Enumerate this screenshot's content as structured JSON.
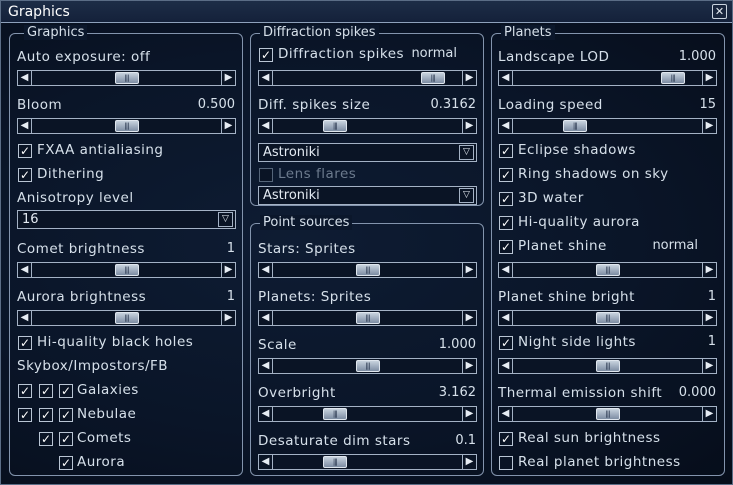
{
  "window": {
    "title": "Graphics",
    "close_glyph": "✕"
  },
  "icons": {
    "check": "✓",
    "left": "◀",
    "right": "▶",
    "thumb": "|||",
    "dropdown": "▽"
  },
  "graphics": {
    "title": "Graphics",
    "auto_exposure_label": "Auto exposure: off",
    "auto_exposure_pos": 0.5,
    "bloom_label": "Bloom",
    "bloom_value": "0.500",
    "bloom_pos": 0.5,
    "fxaa_label": "FXAA antialiasing",
    "fxaa_checked": true,
    "dithering_label": "Dithering",
    "dithering_checked": true,
    "anisotropy_label": "Anisotropy level",
    "anisotropy_value": "16",
    "comet_label": "Comet brightness",
    "comet_value": "1",
    "comet_pos": 0.5,
    "aurora_label": "Aurora brightness",
    "aurora_value": "1",
    "aurora_pos": 0.5,
    "hq_black_holes_label": "Hi-quality black holes",
    "hq_black_holes_checked": true,
    "skybox_label": "Skybox/Impostors/FB",
    "galaxies_label": "Galaxies",
    "nebulae_label": "Nebulae",
    "comets_label": "Comets",
    "aurora_item_label": "Aurora"
  },
  "diffraction": {
    "title": "Diffraction spikes",
    "spikes_label": "Diffraction spikes",
    "spikes_mode": "normal",
    "spikes_checked": true,
    "spikes_pos": 0.9,
    "size_label": "Diff. spikes size",
    "size_value": "0.3162",
    "size_pos": 0.3,
    "dropdown1_value": "Astroniki",
    "lens_flares_label": "Lens flares",
    "lens_flares_checked": false,
    "dropdown2_value": "Astroniki"
  },
  "point_sources": {
    "title": "Point sources",
    "stars_label": "Stars: Sprites",
    "stars_pos": 0.5,
    "planets_label": "Planets: Sprites",
    "planets_pos": 0.5,
    "scale_label": "Scale",
    "scale_value": "1.000",
    "scale_pos": 0.5,
    "overbright_label": "Overbright",
    "overbright_value": "3.162",
    "overbright_pos": 0.3,
    "desaturate_label": "Desaturate dim stars",
    "desaturate_value": "0.1",
    "desaturate_pos": 0.3
  },
  "planets": {
    "title": "Planets",
    "landscape_label": "Landscape LOD",
    "landscape_value": "1.000",
    "landscape_pos": 0.9,
    "loading_label": "Loading speed",
    "loading_value": "15",
    "loading_pos": 0.3,
    "eclipse_label": "Eclipse shadows",
    "eclipse_checked": true,
    "ring_label": "Ring shadows on sky",
    "ring_checked": true,
    "water_label": "3D water",
    "water_checked": true,
    "hq_aurora_label": "Hi-quality aurora",
    "hq_aurora_checked": true,
    "shine_label": "Planet shine",
    "shine_mode": "normal",
    "shine_checked": true,
    "shine_pos": 0.5,
    "shine_bright_label": "Planet shine bright",
    "shine_bright_value": "1",
    "shine_bright_pos": 0.5,
    "night_label": "Night side lights",
    "night_value": "1",
    "night_checked": true,
    "night_pos": 0.5,
    "thermal_label": "Thermal emission shift",
    "thermal_value": "0.000",
    "thermal_pos": 0.5,
    "real_sun_label": "Real sun brightness",
    "real_sun_checked": true,
    "real_planet_label": "Real planet brightness",
    "real_planet_checked": false
  }
}
